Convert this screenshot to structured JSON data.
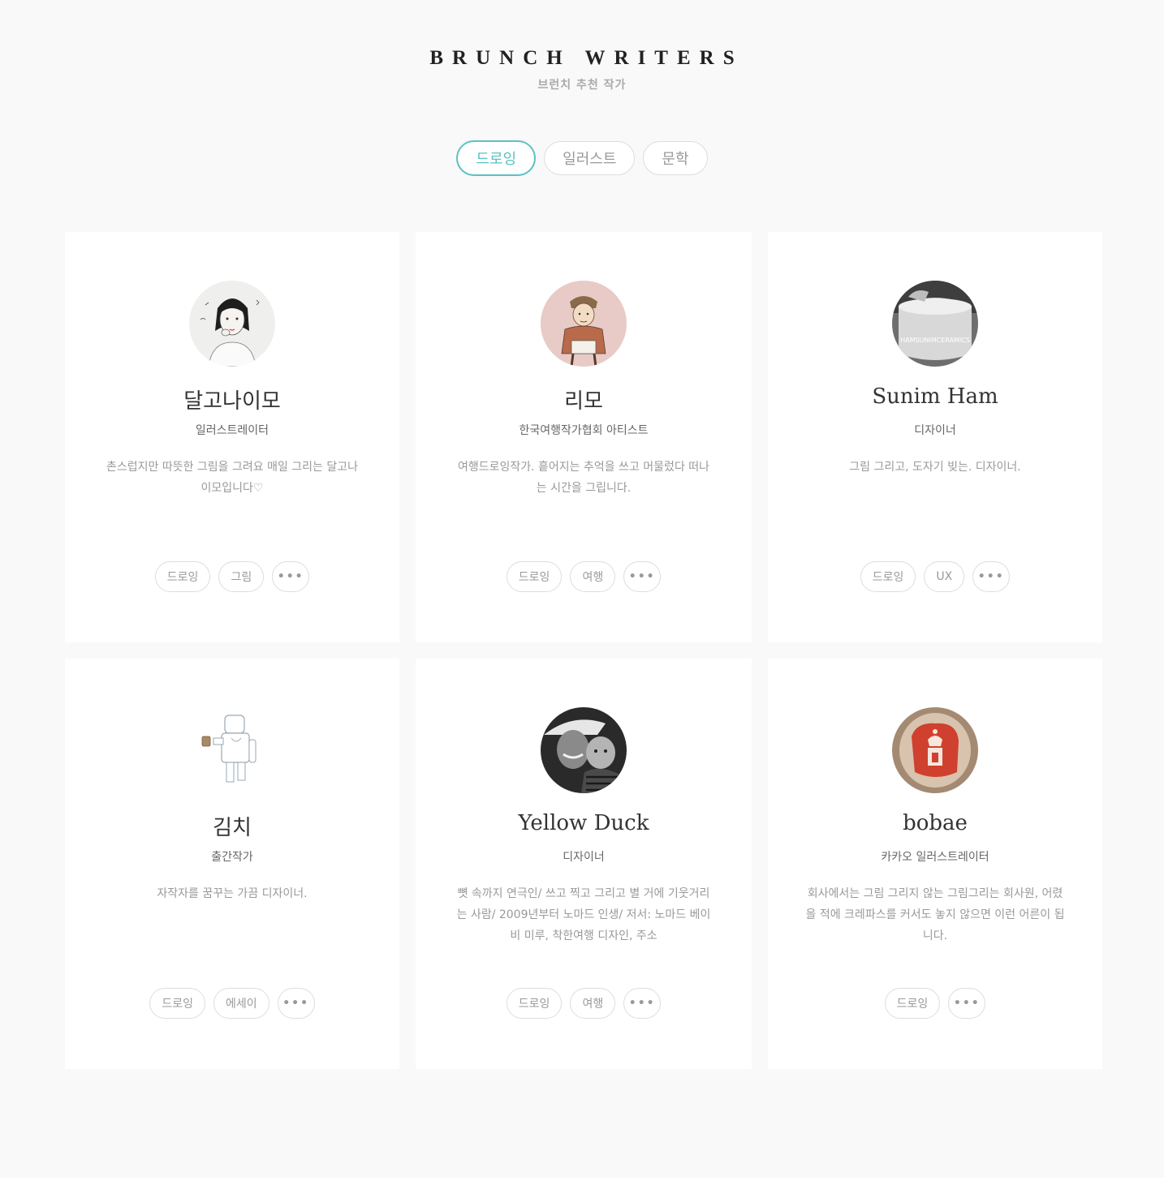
{
  "header": {
    "title": "BRUNCH WRITERS",
    "subtitle": "브런치 추천 작가"
  },
  "tabs": [
    {
      "label": "드로잉",
      "active": true
    },
    {
      "label": "일러스트",
      "active": false
    },
    {
      "label": "문학",
      "active": false
    }
  ],
  "more_label": "•••",
  "writers": [
    {
      "name": "달고나이모",
      "role": "일러스트레이터",
      "desc": "촌스럽지만 따뜻한 그림을 그려요 매일 그리는 달고나이모입니다♡",
      "tags": [
        "드로잉",
        "그림"
      ],
      "avatar_icon": "girl-illustration-avatar"
    },
    {
      "name": "리모",
      "role": "한국여행작가협회 아티스트",
      "desc": "여행드로잉작가. 흩어지는 추억을 쓰고 머물렀다 떠나는 시간을 그립니다.",
      "tags": [
        "드로잉",
        "여행"
      ],
      "avatar_icon": "boy-illustration-avatar"
    },
    {
      "name": "Sunim Ham",
      "role": "디자이너",
      "desc": "그림 그리고, 도자기 빚는. 디자이너.",
      "tags": [
        "드로잉",
        "UX"
      ],
      "avatar_icon": "ceramics-photo-avatar",
      "avatar_text": "HAMSUNIMCERAMICS"
    },
    {
      "name": "김치",
      "role": "출간작가",
      "desc": "자작자를 꿈꾸는 가끔 디자이너.",
      "tags": [
        "드로잉",
        "에세이"
      ],
      "avatar_icon": "robot-drawing-avatar"
    },
    {
      "name": "Yellow Duck",
      "role": "디자이너",
      "desc": "뼛 속까지 연극인/ 쓰고 찍고 그리고 별 거에 기웃거리는 사람/ 2009년부터 노마드 인생/ 저서: 노마드 베이비 미루, 착한여행 디자인, 주소",
      "tags": [
        "드로잉",
        "여행"
      ],
      "avatar_icon": "family-photo-avatar"
    },
    {
      "name": "bobae",
      "role": "카카오 일러스트레이터",
      "desc": "회사에서는 그림 그리지 않는 그림그리는 회사원, 어렸을 적에 크레파스를 커서도 놓지 않으면 이런 어른이 됩니다.",
      "tags": [
        "드로잉"
      ],
      "avatar_icon": "crayon-drawing-avatar"
    }
  ]
}
